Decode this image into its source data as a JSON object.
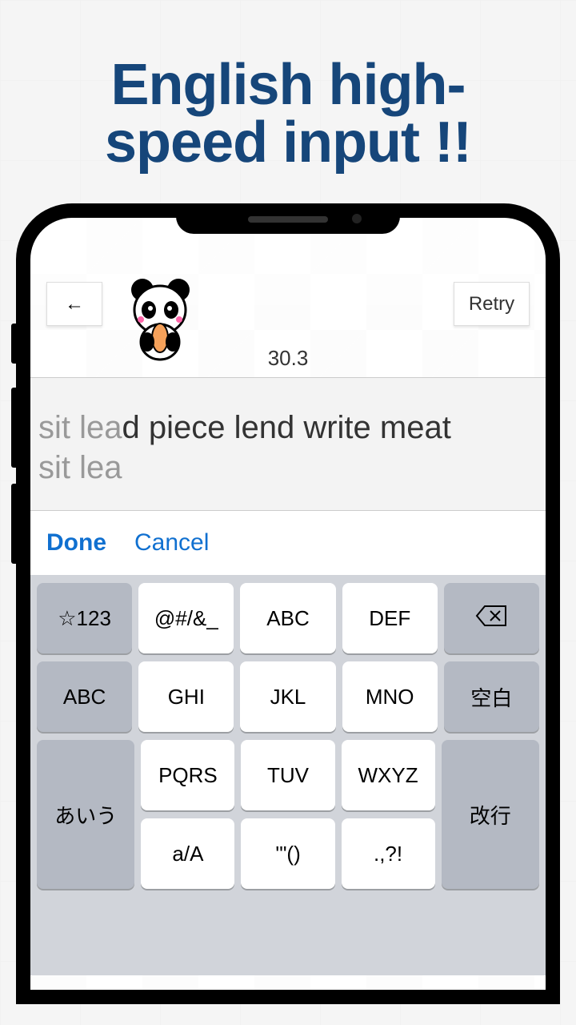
{
  "headline_line1": "English high-",
  "headline_line2": "speed input !!",
  "topbar": {
    "back_arrow": "←",
    "timer_value": "30.3",
    "retry_label": "Retry"
  },
  "typing": {
    "target_faded": "sit lea",
    "target_rest": "d piece lend write meat",
    "input_value": "sit lea"
  },
  "toolbar": {
    "done_label": "Done",
    "cancel_label": "Cancel"
  },
  "keyboard": {
    "row1": [
      "☆123",
      "@#/&_",
      "ABC",
      "DEF"
    ],
    "row2_left": "ABC",
    "row2_mid": [
      "GHI",
      "JKL",
      "MNO"
    ],
    "row2_right": "空白",
    "row3_mid": [
      "PQRS",
      "TUV",
      "WXYZ"
    ],
    "row34_left": "あいう",
    "row34_right": "改行",
    "row4_mid": [
      "a/A",
      "'\"()",
      ".,?!"
    ],
    "backspace_name": "backspace"
  }
}
